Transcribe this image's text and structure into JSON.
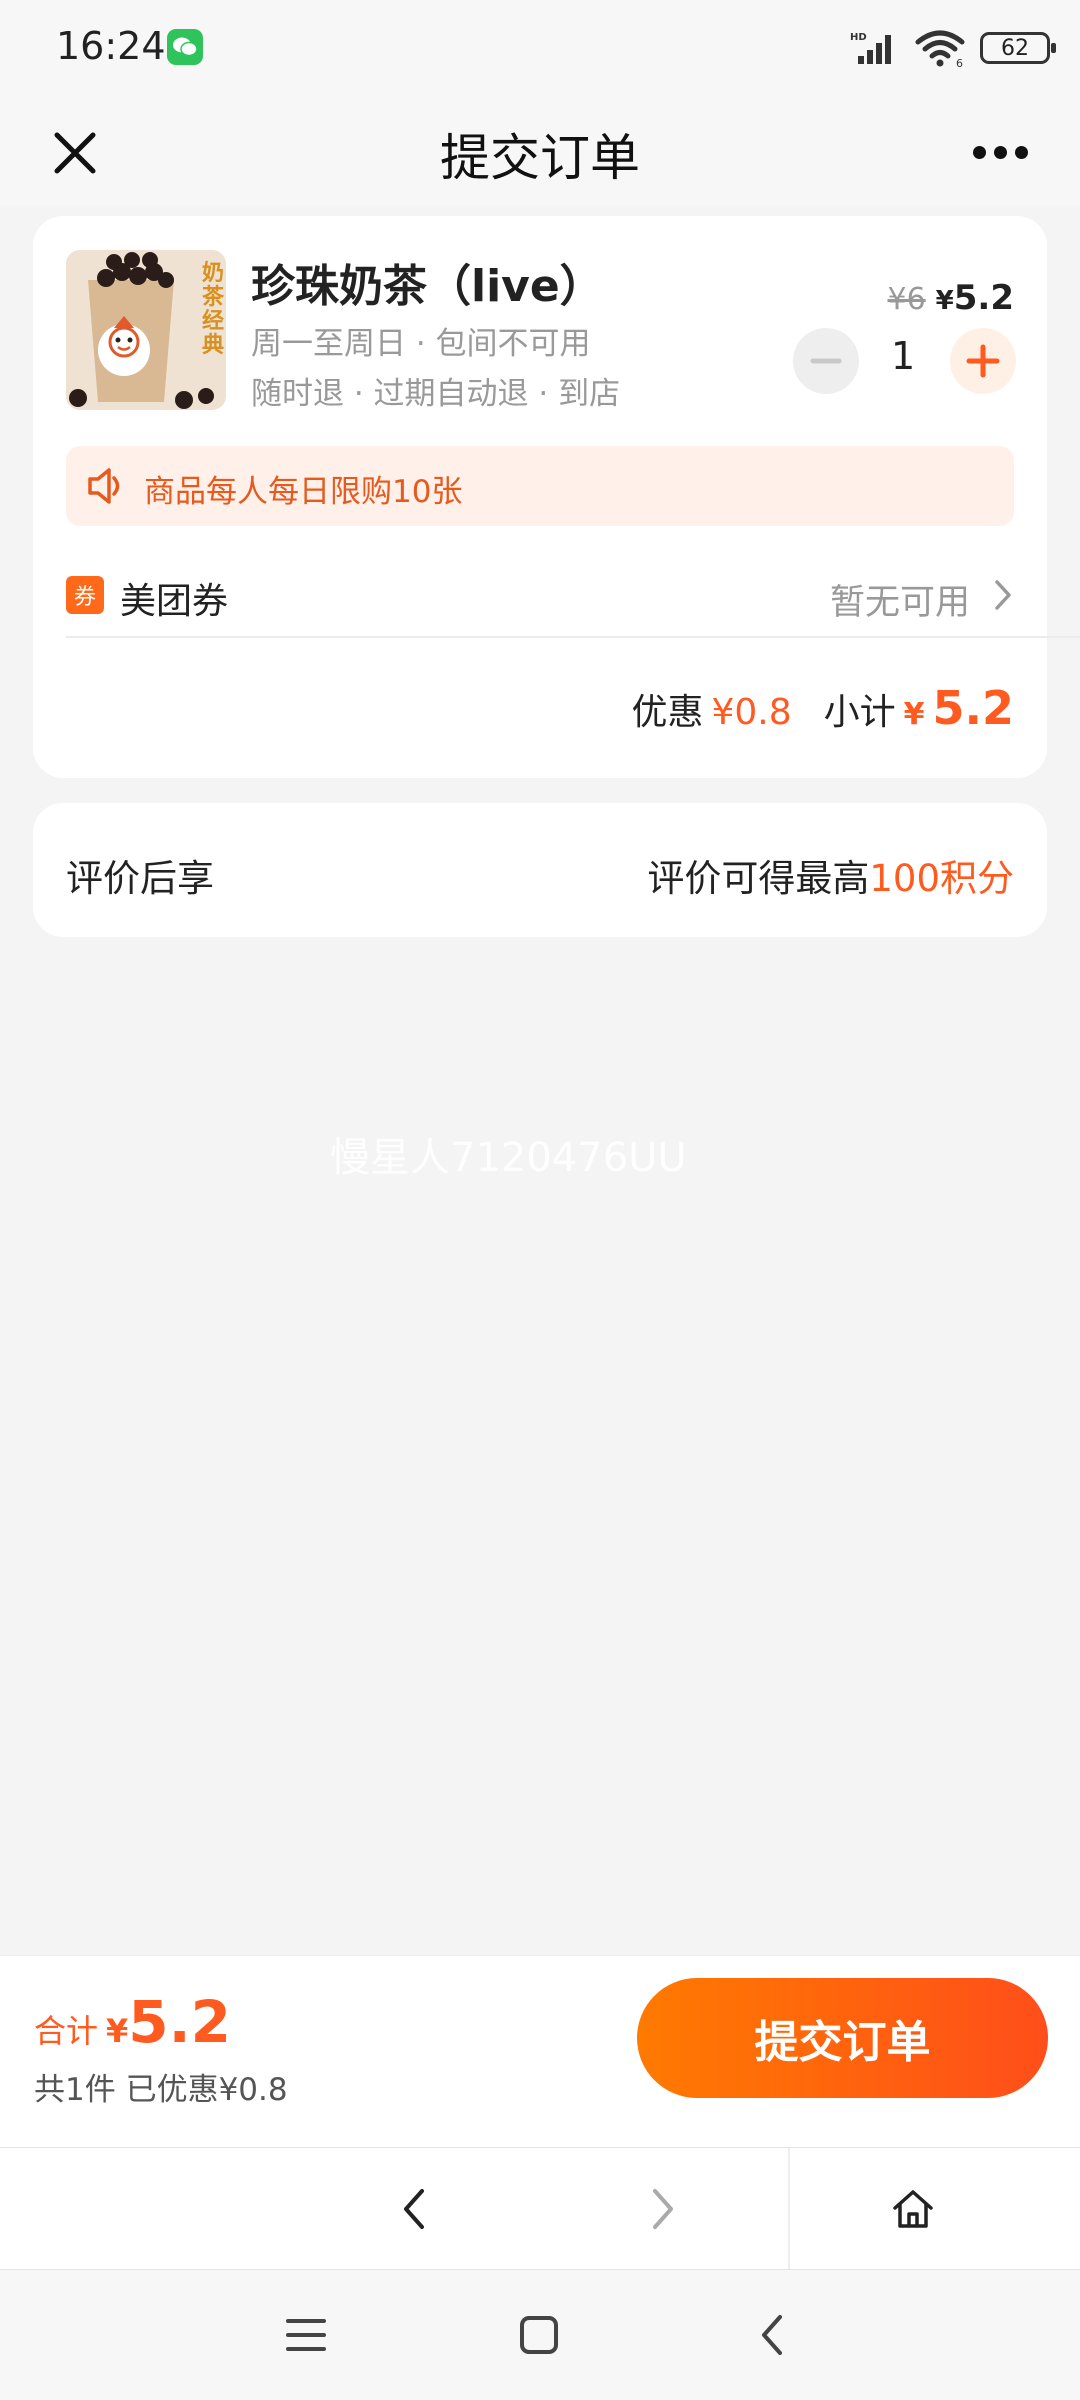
{
  "status_bar": {
    "time": "16:24",
    "battery": "62"
  },
  "header": {
    "title": "提交订单"
  },
  "order": {
    "product_name": "珍珠奶茶（live）",
    "product_sub1": "周一至周日 · 包间不可用",
    "product_sub2": "随时退 · 过期自动退 · 到店",
    "image_text": "奶茶经典",
    "original_price": "¥6",
    "current_price_yen": "¥",
    "current_price": "5.2",
    "quantity": "1",
    "limit_notice": "商品每人每日限购10张",
    "coupon_tag": "券",
    "coupon_label": "美团券",
    "coupon_value": "暂无可用",
    "discount_label": "优惠",
    "discount_value": "¥0.8",
    "subtotal_label": "小计",
    "subtotal_yen": "¥",
    "subtotal_value": "5.2"
  },
  "review": {
    "left": "评价后享",
    "right_prefix": "评价可得最高",
    "right_highlight": "100积分"
  },
  "watermark": "慢星人7120476UU",
  "bottom": {
    "total_label": "合计",
    "total_yen": "¥",
    "total_value": "5.2",
    "count_text": "共1件  已优惠¥0.8",
    "submit_label": "提交订单"
  },
  "colors": {
    "accent": "#ff5a1f",
    "button_start": "#ff7a00",
    "button_end": "#ff4e1a",
    "banner_bg": "#fff0ea"
  },
  "icons": [
    "close-icon",
    "more-icon",
    "minus-icon",
    "plus-icon",
    "speaker-icon",
    "chevron-right-icon",
    "back-icon",
    "forward-icon",
    "home-icon",
    "menu-icon",
    "square-icon"
  ]
}
